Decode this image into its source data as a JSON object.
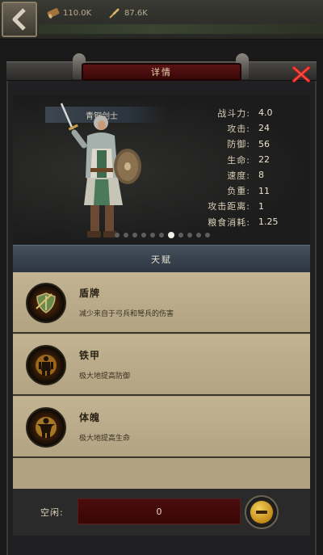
{
  "resources": {
    "wood": "110.0K",
    "food": "87.6K"
  },
  "header": {
    "title": "详情"
  },
  "unit": {
    "name": "青铜剑士",
    "stats": [
      {
        "label": "战斗力:",
        "value": "4.0"
      },
      {
        "label": "攻击:",
        "value": "24"
      },
      {
        "label": "防御:",
        "value": "56"
      },
      {
        "label": "生命:",
        "value": "22"
      },
      {
        "label": "速度:",
        "value": "8"
      },
      {
        "label": "负重:",
        "value": "11"
      },
      {
        "label": "攻击距离:",
        "value": "1"
      },
      {
        "label": "粮食消耗:",
        "value": "1.25"
      }
    ],
    "page_count": 11,
    "page_index": 6
  },
  "talents": {
    "header": "天赋",
    "items": [
      {
        "icon": "shield-icon",
        "title": "盾牌",
        "desc": "减少来自于弓兵和弩兵的伤害"
      },
      {
        "icon": "iron-armor-icon",
        "title": "铁甲",
        "desc": "极大地提高防御"
      },
      {
        "icon": "physique-icon",
        "title": "体魄",
        "desc": "极大地提高生命"
      }
    ]
  },
  "idle": {
    "label": "空闲:",
    "value": "0"
  },
  "colors": {
    "accent_red": "#5a1313",
    "talent_bg": "#b1a382",
    "close_red": "#d02020",
    "minus_gold": "#e0b23a"
  }
}
